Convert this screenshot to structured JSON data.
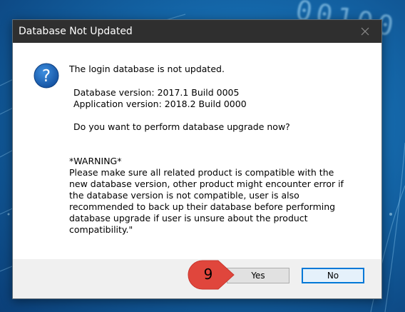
{
  "dialog": {
    "title": "Database Not Updated",
    "close_icon": "close-icon",
    "icon": "question-icon",
    "heading": "The login database is not updated.",
    "database_version": "Database version: 2017.1 Build 0005",
    "application_version": "Application version: 2018.2 Build 0000",
    "question": "Do you want to perform database upgrade now?",
    "warning": "*WARNING*\nPlease make sure all related product is compatible with the\nnew database version, other product might encounter error if\nthe database version is not compatible, user is also\nrecommended to back up their database before performing\ndatabase upgrade if user is unsure about the product\ncompatibility.\"",
    "buttons": {
      "yes": "Yes",
      "no": "No"
    }
  },
  "callout": {
    "number": "9",
    "color": "#e0463c"
  },
  "background": {
    "digits": "00100"
  },
  "colors": {
    "titlebar": "#2f2f2f",
    "focus_border": "#0078d7",
    "icon_blue": "#1a5fb4"
  }
}
